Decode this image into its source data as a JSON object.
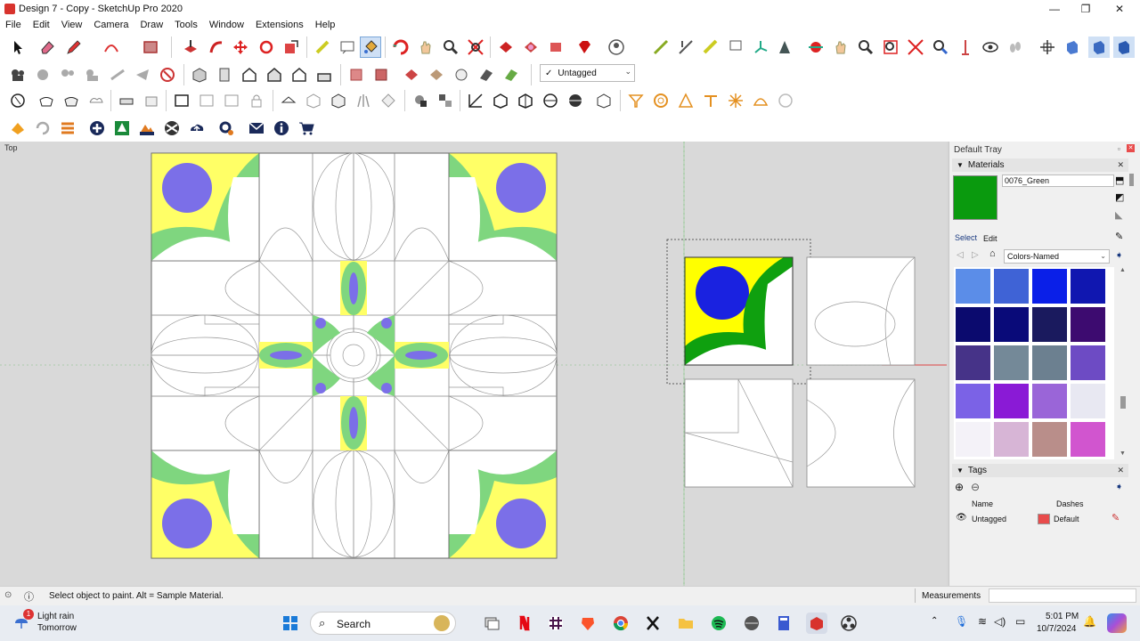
{
  "window": {
    "title": "Design 7 - Copy - SketchUp Pro 2020",
    "minimize": "—",
    "maximize": "❐",
    "close": "✕"
  },
  "menu": [
    "File",
    "Edit",
    "View",
    "Camera",
    "Draw",
    "Tools",
    "Window",
    "Extensions",
    "Help"
  ],
  "tag_selector": {
    "check": "✓",
    "value": "Untagged"
  },
  "viewport": {
    "view_name": "Top"
  },
  "tray": {
    "title": "Default Tray",
    "materials": {
      "header": "Materials",
      "current_name": "0076_Green",
      "current_color": "#0a9a0e",
      "tab_select": "Select",
      "tab_edit": "Edit",
      "library": "Colors-Named",
      "swatches": [
        "#5b8de8",
        "#3f63d6",
        "#0a1fe8",
        "#1017b0",
        "#0b0a6e",
        "#090a79",
        "#1a1a5e",
        "#3d0b70",
        "#463388",
        "#748998",
        "#6c8090",
        "#6d4bc4",
        "#7b62e6",
        "#8a1ad6",
        "#9a65d8",
        "#e8e8f2",
        "#f4f2f8",
        "#d7b5d6",
        "#b98e8a",
        "#d155cf",
        "#b64cc6",
        "#8c1ac2",
        "#8a0f9a",
        "#8e0d8a"
      ]
    },
    "tags": {
      "header": "Tags",
      "col_name": "Name",
      "col_dashes": "Dashes",
      "row_name": "Untagged",
      "row_dashes": "Default",
      "row_color": "#e84b4b"
    }
  },
  "status": {
    "hint": "Select object to paint. Alt = Sample Material.",
    "measurements_label": "Measurements"
  },
  "taskbar": {
    "weather_line1": "Light rain",
    "weather_line2": "Tomorrow",
    "weather_badge": "1",
    "search": "Search",
    "time": "5:01 PM",
    "date": "10/7/2024"
  },
  "colors": {
    "yellow": "#ffff66",
    "light_green": "#7fd67f",
    "periwinkle": "#7b6fe8",
    "blue": "#1a22e0",
    "green": "#0fa00f"
  }
}
